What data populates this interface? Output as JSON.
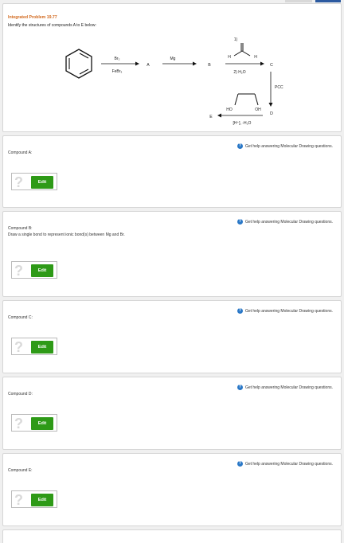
{
  "problem": {
    "title": "Integrated Problem 19.77",
    "instruction": "Identify the structures of compounds A to E below:"
  },
  "scheme": {
    "reagent1_top": "Br₂",
    "reagent1_bottom": "FeBr₃",
    "compound_a": "A",
    "reagent2_top": "Mg",
    "compound_b": "B",
    "step1": "1)",
    "aldehyde_h_left": "H",
    "aldehyde_h_right": "H",
    "step2": "2) H₂O",
    "compound_c": "C",
    "reagent_pcc": "PCC",
    "compound_d": "D",
    "diol_ho": "HO",
    "diol_oh": "OH",
    "reagent_acetal": "[H⁺], -H₂O",
    "compound_e": "E"
  },
  "help_text": "Get help answering Molecular Drawing questions.",
  "edit_label": "Edit",
  "qmark": "?",
  "compounds": [
    {
      "label": "Compound A:",
      "note": ""
    },
    {
      "label": "Compound B:",
      "note": "Draw a single bond to represent ionic bond(s) between Mg and Br."
    },
    {
      "label": "Compound C:",
      "note": ""
    },
    {
      "label": "Compound D:",
      "note": ""
    },
    {
      "label": "Compound E:",
      "note": ""
    }
  ]
}
